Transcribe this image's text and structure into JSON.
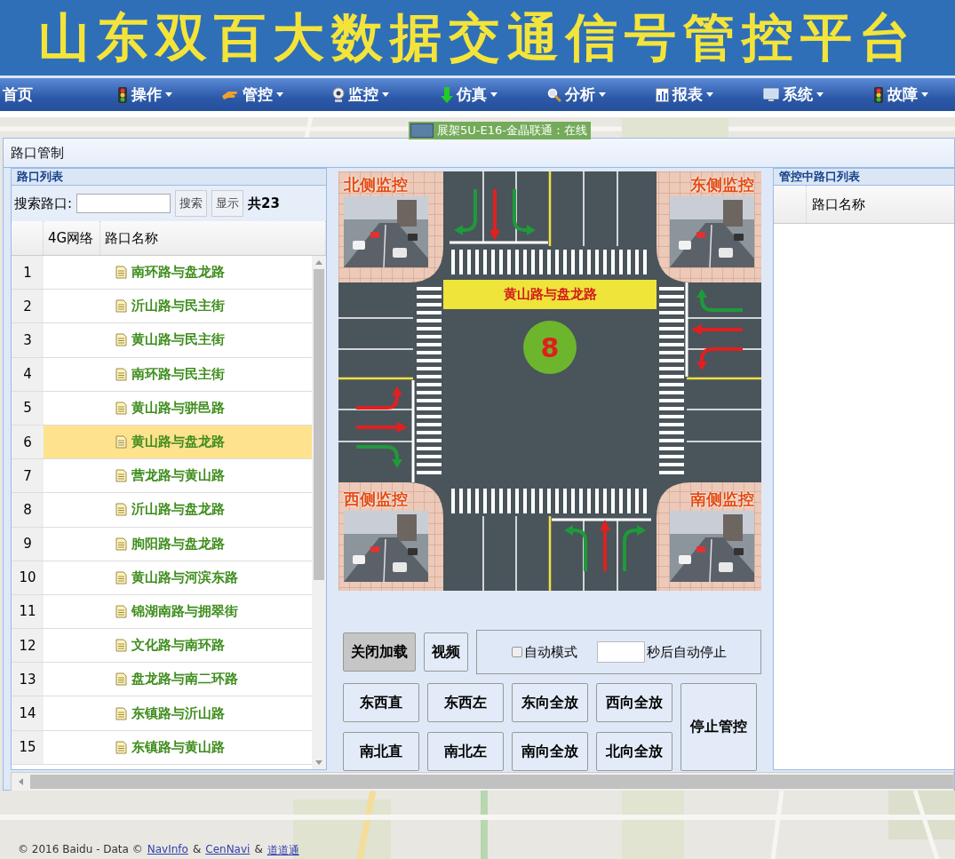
{
  "banner": {
    "title": "山东双百大数据交通信号管控平台"
  },
  "nav": [
    {
      "label": "首页",
      "kind": "home"
    },
    {
      "label": "操作",
      "kind": "traffic-light"
    },
    {
      "label": "管控",
      "kind": "hand"
    },
    {
      "label": "监控",
      "kind": "webcam"
    },
    {
      "label": "仿真",
      "kind": "download"
    },
    {
      "label": "分析",
      "kind": "magnifier"
    },
    {
      "label": "报表",
      "kind": "report"
    },
    {
      "label": "系统",
      "kind": "monitor"
    },
    {
      "label": "故障",
      "kind": "traffic-light"
    }
  ],
  "map": {
    "marker_label": "展架5U-E16-金晶联通：在线",
    "copyright": [
      {
        "text": "© 2016 Baidu - Data ©",
        "kind": "text"
      },
      {
        "text": "NavInfo",
        "kind": "link"
      },
      {
        "text": "&",
        "kind": "text"
      },
      {
        "text": "CenNavi",
        "kind": "link"
      },
      {
        "text": "&",
        "kind": "text"
      },
      {
        "text": "道道通",
        "kind": "link"
      }
    ]
  },
  "dialog": {
    "title": "路口管制"
  },
  "left_panel": {
    "title": "路口列表",
    "search_label": "搜索路口:",
    "search_button": "搜索",
    "show_button": "显示",
    "total": "共23",
    "columns": [
      "4G网络",
      "路口名称"
    ],
    "rows": [
      {
        "index": "1",
        "name": "南环路与盘龙路",
        "selected": false
      },
      {
        "index": "2",
        "name": "沂山路与民主街",
        "selected": false
      },
      {
        "index": "3",
        "name": "黄山路与民主街",
        "selected": false
      },
      {
        "index": "4",
        "name": "南环路与民主街",
        "selected": false
      },
      {
        "index": "5",
        "name": "黄山路与骈邑路",
        "selected": false
      },
      {
        "index": "6",
        "name": "黄山路与盘龙路",
        "selected": true
      },
      {
        "index": "7",
        "name": "营龙路与黄山路",
        "selected": false
      },
      {
        "index": "8",
        "name": "沂山路与盘龙路",
        "selected": false
      },
      {
        "index": "9",
        "name": "朐阳路与盘龙路",
        "selected": false
      },
      {
        "index": "10",
        "name": "黄山路与河滨东路",
        "selected": false
      },
      {
        "index": "11",
        "name": "锦湖南路与拥翠街",
        "selected": false
      },
      {
        "index": "12",
        "name": "文化路与南环路",
        "selected": false
      },
      {
        "index": "13",
        "name": "盘龙路与南二环路",
        "selected": false
      },
      {
        "index": "14",
        "name": "东镇路与沂山路",
        "selected": false
      },
      {
        "index": "15",
        "name": "东镇路与黄山路",
        "selected": false
      }
    ]
  },
  "intersection": {
    "name": "黄山路与盘龙路",
    "phase": "8",
    "cameras": [
      {
        "label": "北侧监控",
        "kind": "nw"
      },
      {
        "label": "东侧监控",
        "kind": "ne"
      },
      {
        "label": "西侧监控",
        "kind": "sw"
      },
      {
        "label": "南侧监控",
        "kind": "se"
      }
    ],
    "approaches": [
      {
        "kind": "north",
        "arrows": [
          {
            "kind": "left",
            "color": "#1e9a3a"
          },
          {
            "kind": "straight",
            "color": "#e02020"
          },
          {
            "kind": "right",
            "color": "#1e9a3a"
          }
        ]
      },
      {
        "kind": "east",
        "arrows": [
          {
            "kind": "left",
            "color": "#e02020"
          },
          {
            "kind": "straight",
            "color": "#e02020"
          },
          {
            "kind": "right",
            "color": "#1e9a3a"
          }
        ]
      },
      {
        "kind": "west",
        "arrows": [
          {
            "kind": "left",
            "color": "#e02020"
          },
          {
            "kind": "straight",
            "color": "#e02020"
          },
          {
            "kind": "right",
            "color": "#1e9a3a"
          }
        ]
      },
      {
        "kind": "south",
        "arrows": [
          {
            "kind": "left",
            "color": "#1e9a3a"
          },
          {
            "kind": "straight",
            "color": "#e02020"
          },
          {
            "kind": "right",
            "color": "#1e9a3a"
          }
        ]
      }
    ]
  },
  "controls": {
    "top": [
      {
        "label": "关闭加载",
        "active": true
      },
      {
        "label": "视频",
        "active": false
      }
    ],
    "auto": {
      "label": "自动模式",
      "checked": false,
      "suffix": "秒后自动停止"
    },
    "phases": [
      "东西直",
      "东西左",
      "东向全放",
      "西向全放",
      "南北直",
      "南北左",
      "南向全放",
      "北向全放"
    ],
    "stop": "停止管控"
  },
  "right_panel": {
    "title": "管控中路口列表",
    "columns": [
      "路口名称"
    ]
  }
}
